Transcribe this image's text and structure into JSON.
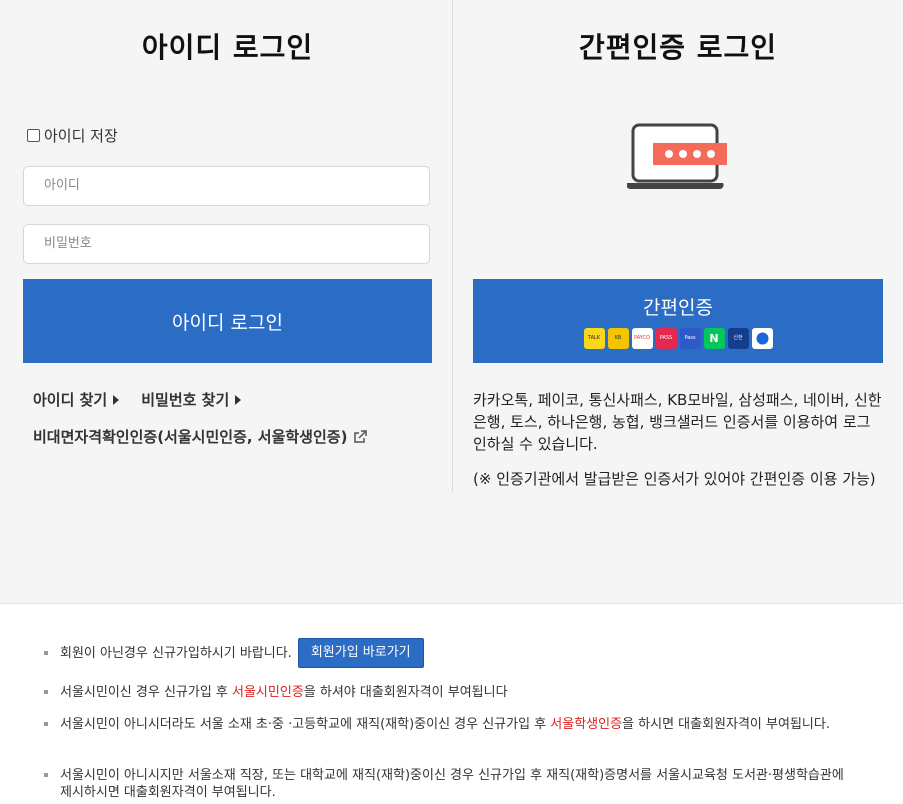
{
  "id_login": {
    "title": "아이디 로그인",
    "save_id_label": "아이디 저장",
    "id_placeholder": "아이디",
    "password_placeholder": "비밀번호",
    "login_button": "아이디 로그인",
    "find_id": "아이디 찾기",
    "find_password": "비밀번호 찾기",
    "cert_link": "비대면자격확인인증(서울시민인증, 서울학생인증)"
  },
  "easy_login": {
    "title": "간편인증 로그인",
    "button_label": "간편인증",
    "providers": [
      {
        "name": "kakaotalk",
        "label": "TALK",
        "color": "#f9d71c"
      },
      {
        "name": "kb",
        "label": "KB",
        "color": "#f4c400"
      },
      {
        "name": "payco",
        "label": "PAYCO",
        "color": "#e8352f"
      },
      {
        "name": "pass",
        "label": "PASS",
        "color": "#e5284f"
      },
      {
        "name": "samsung-pass",
        "label": "Pass",
        "color": "#2d59c9"
      },
      {
        "name": "naver",
        "label": "N",
        "color": "#03c75a"
      },
      {
        "name": "shinhan",
        "label": "신한",
        "color": "#143d8c"
      },
      {
        "name": "toss",
        "label": "toss",
        "color": "#1b64da"
      }
    ],
    "description": "카카오톡, 페이코, 통신사패스, KB모바일, 삼성패스, 네이버, 신한은행, 토스, 하나은행, 농협, 뱅크샐러드 인증서를 이용하여 로그인하실 수 있습니다.",
    "note": "(※ 인증기관에서 발급받은 인증서가 있어야 간편인증 이용 가능)"
  },
  "notices": {
    "item1": "회원이 아닌경우 신규가입하시기 바랍니다.",
    "join_button": "회원가입 바로가기",
    "item2_pre": "서울시민이신 경우 신규가입 후 ",
    "item2_red": "서울시민인증",
    "item2_post": "을 하셔야 대출회원자격이 부여됩니다",
    "item3_pre": "서울시민이 아니시더라도 서울 소재 초·중 ·고등학교에 재직(재학)중이신 경우 신규가입 후 ",
    "item3_red": "서울학생인증",
    "item3_post": "을 하시면 대출회원자격이 부여됩니다.",
    "item4": "서울시민이 아니시지만 서울소재 직장, 또는 대학교에 재직(재학)중이신 경우 신규가입 후 재직(재학)증명서를 서울시교육청 도서관·평생학습관에 제시하시면 대출회원자격이 부여됩니다."
  }
}
